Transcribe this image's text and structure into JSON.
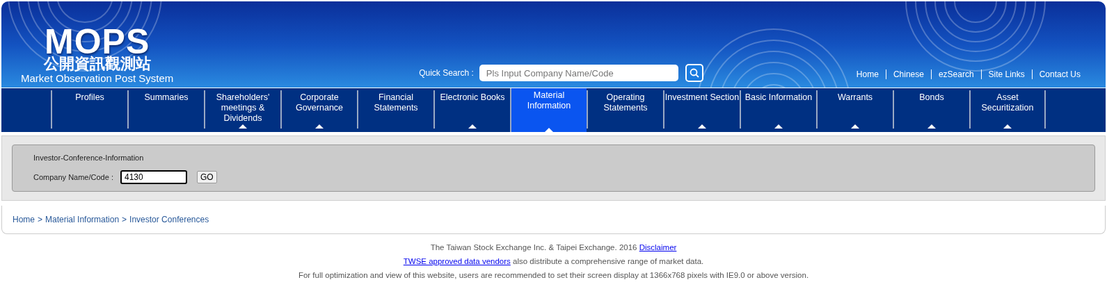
{
  "logo": {
    "mark": "MOPS",
    "chinese": "公開資訊觀測站",
    "subtitle": "Market Observation Post System"
  },
  "quick_search": {
    "label": "Quick Search :",
    "placeholder": "Pls Input Company Name/Code"
  },
  "top_links": [
    "Home",
    "Chinese",
    "ezSearch",
    "Site Links",
    "Contact Us"
  ],
  "nav": [
    {
      "label": "Profiles",
      "selected": false,
      "submenu": false
    },
    {
      "label": "Summaries",
      "selected": false,
      "submenu": false
    },
    {
      "label": "Shareholders' meetings & Dividends",
      "selected": false,
      "submenu": true
    },
    {
      "label": "Corporate Governance",
      "selected": false,
      "submenu": true
    },
    {
      "label": "Financial Statements",
      "selected": false,
      "submenu": false
    },
    {
      "label": "Electronic Books",
      "selected": false,
      "submenu": true
    },
    {
      "label": "Material Information",
      "selected": true,
      "submenu": true
    },
    {
      "label": "Operating Statements",
      "selected": false,
      "submenu": false
    },
    {
      "label": "Investment Section",
      "selected": false,
      "submenu": true
    },
    {
      "label": "Basic Information",
      "selected": false,
      "submenu": true
    },
    {
      "label": "Warrants",
      "selected": false,
      "submenu": true
    },
    {
      "label": "Bonds",
      "selected": false,
      "submenu": true
    },
    {
      "label": "Asset Securitization",
      "selected": false,
      "submenu": true
    }
  ],
  "query": {
    "title": "Investor-Conference-Information",
    "label": "Company Name/Code :",
    "value": "4130",
    "button": "GO"
  },
  "breadcrumb": {
    "separator": ">",
    "items": [
      "Home",
      "Material Information",
      "Investor Conferences"
    ]
  },
  "footer": [
    {
      "before": "The Taiwan Stock Exchange Inc. & Taipei Exchange. 2016 ",
      "link": "Disclaimer"
    },
    {
      "link": "TWSE approved data vendors",
      "after": " also distribute a comprehensive range of market data."
    },
    {
      "before": "For full optimization and view of this website, users are recommended to set their screen display at 1366x768 pixels with IE9.0 or above version."
    }
  ]
}
